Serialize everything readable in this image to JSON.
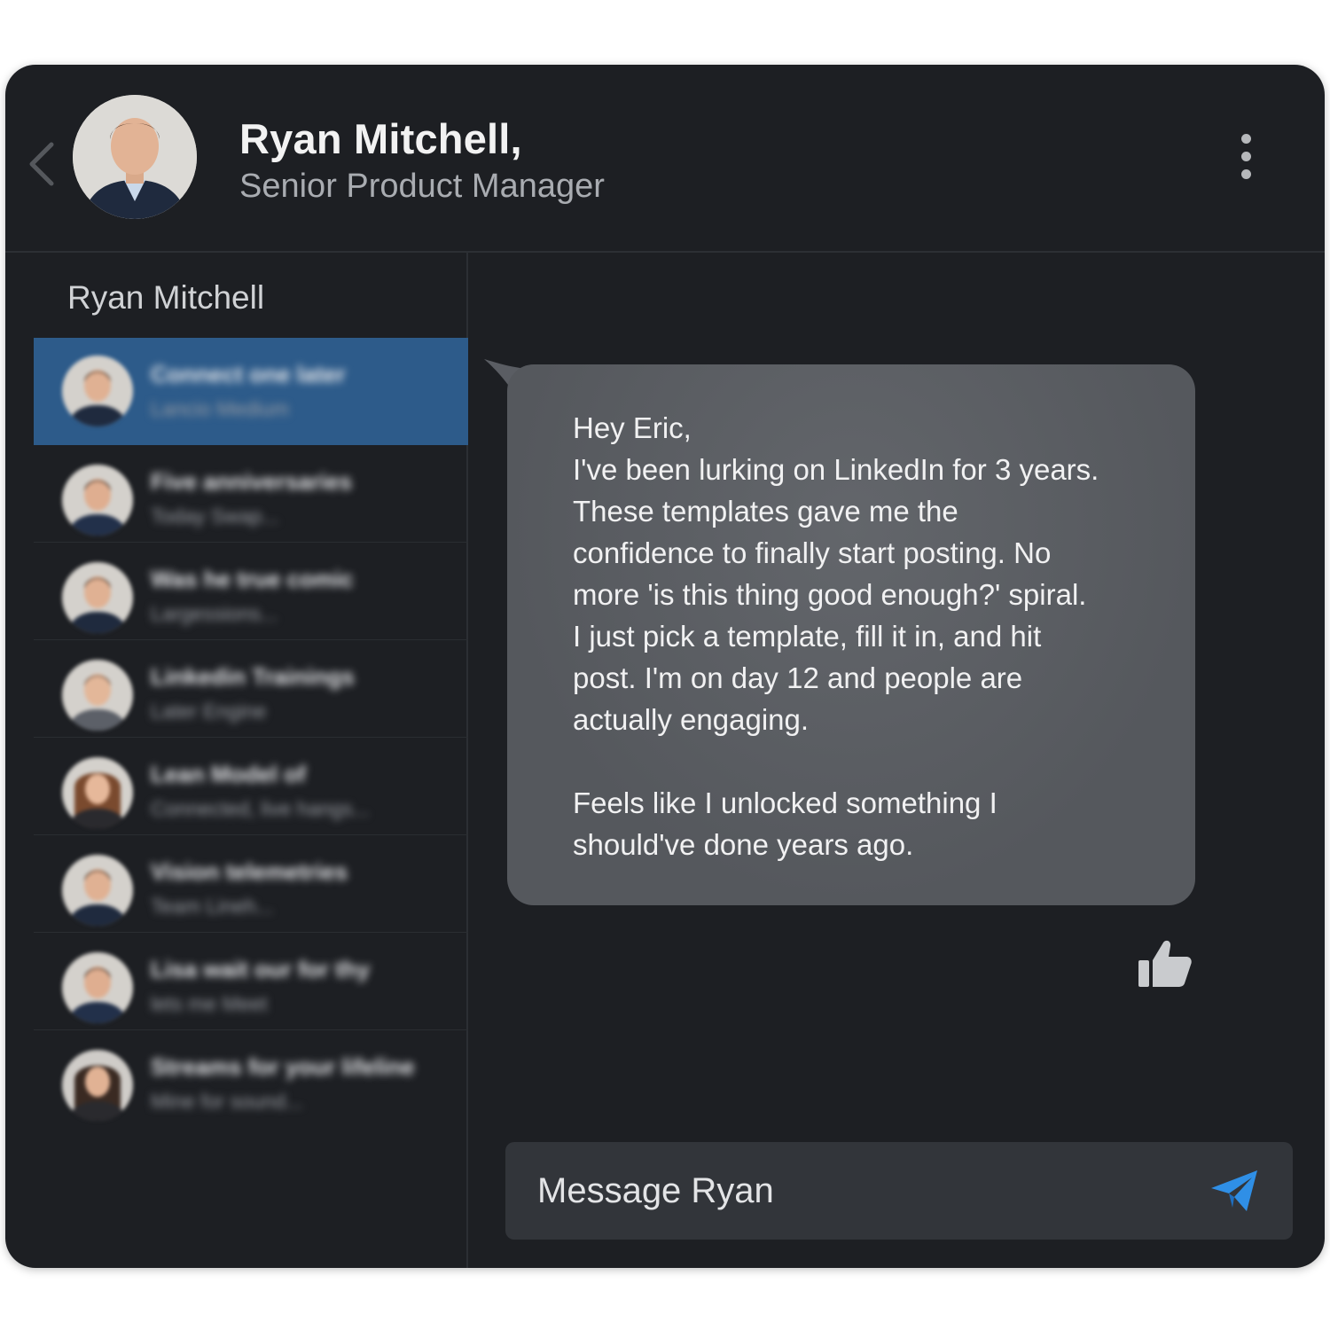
{
  "header": {
    "name": "Ryan Mitchell,",
    "title": "Senior Product Manager"
  },
  "sidebar": {
    "title": "Ryan Mitchell",
    "items": [
      {
        "name": "Connect one later",
        "preview": "Lancio Medium"
      },
      {
        "name": "Five anniversaries",
        "preview": "Today Swap..."
      },
      {
        "name": "Was he true comic",
        "preview": "Largessions..."
      },
      {
        "name": "Linkedin Trainings",
        "preview": "Later Engine"
      },
      {
        "name": "Lean Model of",
        "preview": "Connected, live hangs..."
      },
      {
        "name": "Vision telemetries",
        "preview": "Team Lineh..."
      },
      {
        "name": "Lisa wait our for thy",
        "preview": "lets me Meet"
      },
      {
        "name": "Streams for your lifeline",
        "preview": "Mine for sound..."
      }
    ]
  },
  "message": {
    "text": "Hey Eric,\nI've been lurking on LinkedIn for 3 years.\nThese templates gave me the\nconfidence to finally start posting. No\nmore 'is this thing good enough?' spiral.\nI just pick a template, fill it in, and hit\npost. I'm on day 12 and people are\nactually engaging.\n\nFeels like I unlocked something I\nshould've done years ago."
  },
  "composer": {
    "placeholder": "Message Ryan"
  },
  "icons": {
    "back": "chevron-left-icon",
    "more": "more-vertical-icon",
    "like": "thumbs-up-icon",
    "send": "send-icon"
  },
  "colors": {
    "background": "#1d1f23",
    "active_item": "#2d5b8a",
    "bubble": "#585b61",
    "send_accent": "#2f8fe6"
  }
}
